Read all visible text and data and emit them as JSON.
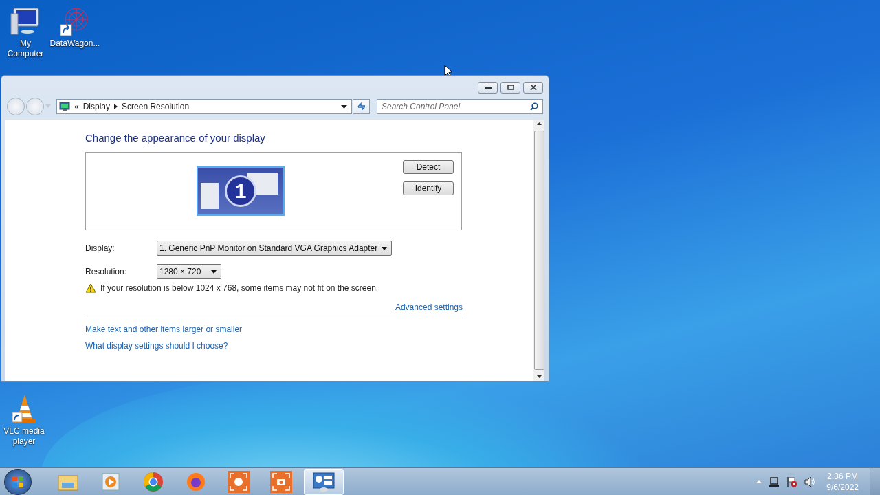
{
  "desktop_icons": [
    {
      "kind": "computer",
      "label": "My Computer"
    },
    {
      "kind": "shortcut",
      "label": "DataWagon..."
    },
    {
      "kind": "cone",
      "label": "VLC media player"
    }
  ],
  "window": {
    "overflow_glyph": "«",
    "breadcrumb": [
      "Display",
      "Screen Resolution"
    ],
    "search": {
      "placeholder": "Search Control Panel"
    }
  },
  "content": {
    "heading": "Change the appearance of your display",
    "monitor_number": "1",
    "buttons": [
      "Detect",
      "Identify"
    ],
    "fields": [
      {
        "label": "Display:",
        "value": "1. Generic PnP Monitor on Standard VGA Graphics Adapter",
        "kind": "wide"
      },
      {
        "label": "Resolution:",
        "value": "1280 × 720",
        "kind": "narrow"
      }
    ],
    "warning": "If your resolution is below 1024 x 768, some items may not fit on the screen.",
    "advanced_link": "Advanced settings",
    "links": [
      "Make text and other items larger or smaller",
      "What display settings should I choose?"
    ]
  },
  "taskbar": {
    "items": [
      {
        "kind": "folder",
        "selected": false
      },
      {
        "kind": "player",
        "selected": false
      },
      {
        "kind": "chrome",
        "selected": false
      },
      {
        "kind": "firefox",
        "selected": false
      },
      {
        "kind": "recorder",
        "selected": false
      },
      {
        "kind": "camera",
        "selected": false
      },
      {
        "kind": "display",
        "selected": true
      }
    ],
    "time": "2:36 PM",
    "date": "9/6/2022"
  }
}
